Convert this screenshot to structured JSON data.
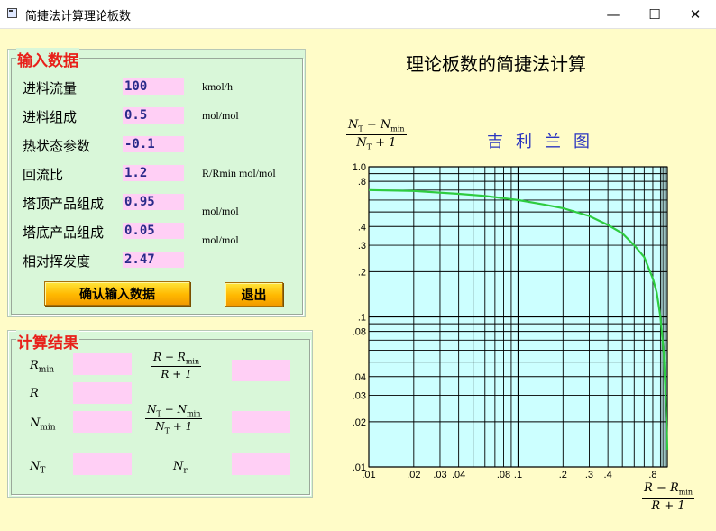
{
  "window": {
    "title": "简捷法计算理论板数",
    "minimize_glyph": "—",
    "maximize_glyph": "☐",
    "close_glyph": "✕"
  },
  "input_panel": {
    "title": "输入数据",
    "fields": [
      {
        "label": "进料流量",
        "value": "100",
        "unit": "kmol/h"
      },
      {
        "label": "进料组成",
        "value": "0.5",
        "unit": "mol/mol"
      },
      {
        "label": "热状态参数",
        "value": "-0.1",
        "unit": ""
      },
      {
        "label": "回流比",
        "value": "1.2",
        "unit": "R/Rmin mol/mol"
      },
      {
        "label": "塔顶产品组成",
        "value": "0.95",
        "unit": "mol/mol"
      },
      {
        "label": "塔底产品组成",
        "value": "0.05",
        "unit": "mol/mol"
      },
      {
        "label": "相对挥发度",
        "value": "2.47",
        "unit": ""
      }
    ],
    "confirm_button": "确认输入数据",
    "exit_button": "退出"
  },
  "result_panel": {
    "title": "计算结果",
    "labels": {
      "rmin": "R",
      "rmin_sub": "min",
      "r": "R",
      "nmin": "N",
      "nmin_sub": "min",
      "nt": "N",
      "nt_sub": "T",
      "nr": "N",
      "nr_sub": "r"
    },
    "frac_r": {
      "num_a": "R",
      "num_op": "−",
      "num_b": "R",
      "num_b_sub": "min",
      "den": "R + 1"
    },
    "frac_n": {
      "num_a": "N",
      "num_a_sub": "T",
      "num_op": "−",
      "num_b": "N",
      "num_b_sub": "min",
      "den_a": "N",
      "den_a_sub": "T",
      "den_b": "+ 1"
    }
  },
  "main_title": "理论板数的简捷法计算",
  "chart": {
    "title": "吉利兰图",
    "y_label": {
      "num_a": "N",
      "num_a_sub": "T",
      "num_op": "−",
      "num_b": "N",
      "num_b_sub": "min",
      "den_a": "N",
      "den_a_sub": "T",
      "den_b": "+ 1"
    },
    "x_label": {
      "num_a": "R",
      "num_op": "−",
      "num_b": "R",
      "num_b_sub": "min",
      "den": "R + 1"
    },
    "colors": {
      "plot_bg": "#ccffff",
      "curve": "#2ecc40",
      "grid": "#000000"
    }
  },
  "chart_data": {
    "type": "line",
    "x_scale": "log",
    "y_scale": "log",
    "xlim": [
      0.01,
      1.0
    ],
    "ylim": [
      0.01,
      1.0
    ],
    "grid": true,
    "x_tick_labels": [
      {
        "v": 0.01,
        "t": ".01"
      },
      {
        "v": 0.02,
        "t": ".02"
      },
      {
        "v": 0.03,
        "t": ".03"
      },
      {
        "v": 0.04,
        "t": ".04"
      },
      {
        "v": 0.08,
        "t": ".08"
      },
      {
        "v": 0.1,
        "t": ".1"
      },
      {
        "v": 0.2,
        "t": ".2"
      },
      {
        "v": 0.3,
        "t": ".3"
      },
      {
        "v": 0.4,
        "t": ".4"
      },
      {
        "v": 0.8,
        "t": ".8"
      }
    ],
    "y_tick_labels": [
      {
        "v": 1.0,
        "t": "1.0"
      },
      {
        "v": 0.8,
        "t": ".8"
      },
      {
        "v": 0.4,
        "t": ".4"
      },
      {
        "v": 0.3,
        "t": ".3"
      },
      {
        "v": 0.2,
        "t": ".2"
      },
      {
        "v": 0.1,
        "t": ".1"
      },
      {
        "v": 0.08,
        "t": ".08"
      },
      {
        "v": 0.04,
        "t": ".04"
      },
      {
        "v": 0.03,
        "t": ".03"
      },
      {
        "v": 0.02,
        "t": ".02"
      },
      {
        "v": 0.01,
        "t": ".01"
      }
    ],
    "series": [
      {
        "x": [
          0.01,
          0.02,
          0.04,
          0.06,
          0.1,
          0.15,
          0.2,
          0.3,
          0.4,
          0.5,
          0.6,
          0.7,
          0.8,
          0.85,
          0.9,
          0.95,
          0.98,
          1.0
        ],
        "y": [
          0.7,
          0.69,
          0.66,
          0.64,
          0.6,
          0.56,
          0.53,
          0.47,
          0.41,
          0.36,
          0.3,
          0.25,
          0.18,
          0.145,
          0.1,
          0.055,
          0.025,
          0.013
        ]
      }
    ]
  }
}
